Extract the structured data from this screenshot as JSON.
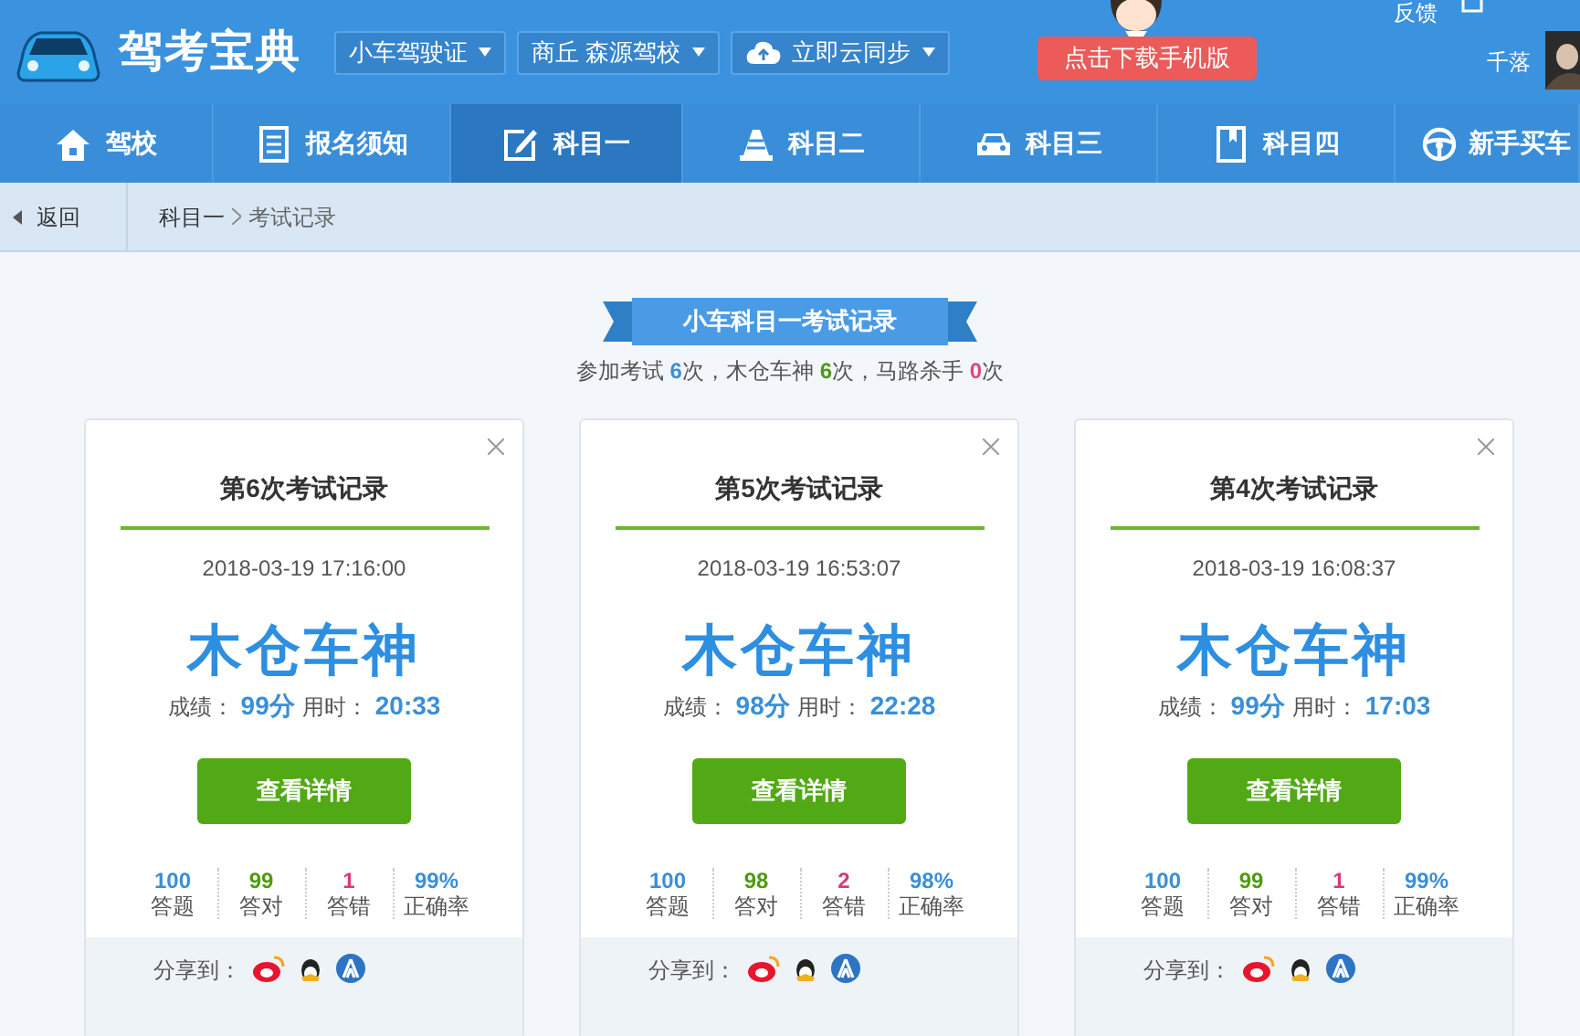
{
  "header": {
    "app_name": "驾考宝典",
    "dropdowns": [
      {
        "label": "小车驾驶证",
        "kind": "plain"
      },
      {
        "label": "商丘 森源驾校",
        "kind": "plain"
      },
      {
        "label": "立即云同步",
        "kind": "cloud"
      }
    ],
    "download_button": "点击下载手机版",
    "feedback": "反馈",
    "user_name": "千落"
  },
  "nav": [
    {
      "label": "驾校",
      "selected": false
    },
    {
      "label": "报名须知",
      "selected": false
    },
    {
      "label": "科目一",
      "selected": true
    },
    {
      "label": "科目二",
      "selected": false
    },
    {
      "label": "科目三",
      "selected": false
    },
    {
      "label": "科目四",
      "selected": false
    },
    {
      "label": "新手买车",
      "selected": false
    }
  ],
  "breadcrumb": {
    "back": "返回",
    "path": "科目一",
    "current": "考试记录"
  },
  "ribbon": "小车科目一考试记录",
  "summary": [
    {
      "text": "参加考试 ",
      "kind": "label"
    },
    {
      "text": "6",
      "kind": "count",
      "color": "#3a8fd6"
    },
    {
      "text": "次，木仓车神 ",
      "kind": "label"
    },
    {
      "text": "6",
      "kind": "count",
      "color": "#4e9a0f"
    },
    {
      "text": "次，马路杀手 ",
      "kind": "label"
    },
    {
      "text": "0",
      "kind": "count",
      "color": "#e0457b"
    },
    {
      "text": "次",
      "kind": "label"
    }
  ],
  "records": [
    {
      "title": "第6次考试记录",
      "time": "2018-03-19 17:16:00",
      "rank": "木仓车神",
      "score_label": "成绩：",
      "score": "99分",
      "duration_label": "用时：",
      "duration": "20:33",
      "button": "查看详情",
      "stats": [
        {
          "value": "100",
          "label": "答题",
          "color": "#3a8fd6"
        },
        {
          "value": "99",
          "label": "答对",
          "color": "#4e9a0f"
        },
        {
          "value": "1",
          "label": "答错",
          "color": "#d63a7a"
        },
        {
          "value": "99%",
          "label": "正确率",
          "color": "#3a8fd6"
        }
      ],
      "share_label": "分享到："
    },
    {
      "title": "第5次考试记录",
      "time": "2018-03-19 16:53:07",
      "rank": "木仓车神",
      "score_label": "成绩：",
      "score": "98分",
      "duration_label": "用时：",
      "duration": "22:28",
      "button": "查看详情",
      "stats": [
        {
          "value": "100",
          "label": "答题",
          "color": "#3a8fd6"
        },
        {
          "value": "98",
          "label": "答对",
          "color": "#4e9a0f"
        },
        {
          "value": "2",
          "label": "答错",
          "color": "#d63a7a"
        },
        {
          "value": "98%",
          "label": "正确率",
          "color": "#3a8fd6"
        }
      ],
      "share_label": "分享到："
    },
    {
      "title": "第4次考试记录",
      "time": "2018-03-19 16:08:37",
      "rank": "木仓车神",
      "score_label": "成绩：",
      "score": "99分",
      "duration_label": "用时：",
      "duration": "17:03",
      "button": "查看详情",
      "stats": [
        {
          "value": "100",
          "label": "答题",
          "color": "#3a8fd6"
        },
        {
          "value": "99",
          "label": "答对",
          "color": "#4e9a0f"
        },
        {
          "value": "1",
          "label": "答错",
          "color": "#d63a7a"
        },
        {
          "value": "99%",
          "label": "正确率",
          "color": "#3a8fd6"
        }
      ],
      "share_label": "分享到："
    }
  ]
}
